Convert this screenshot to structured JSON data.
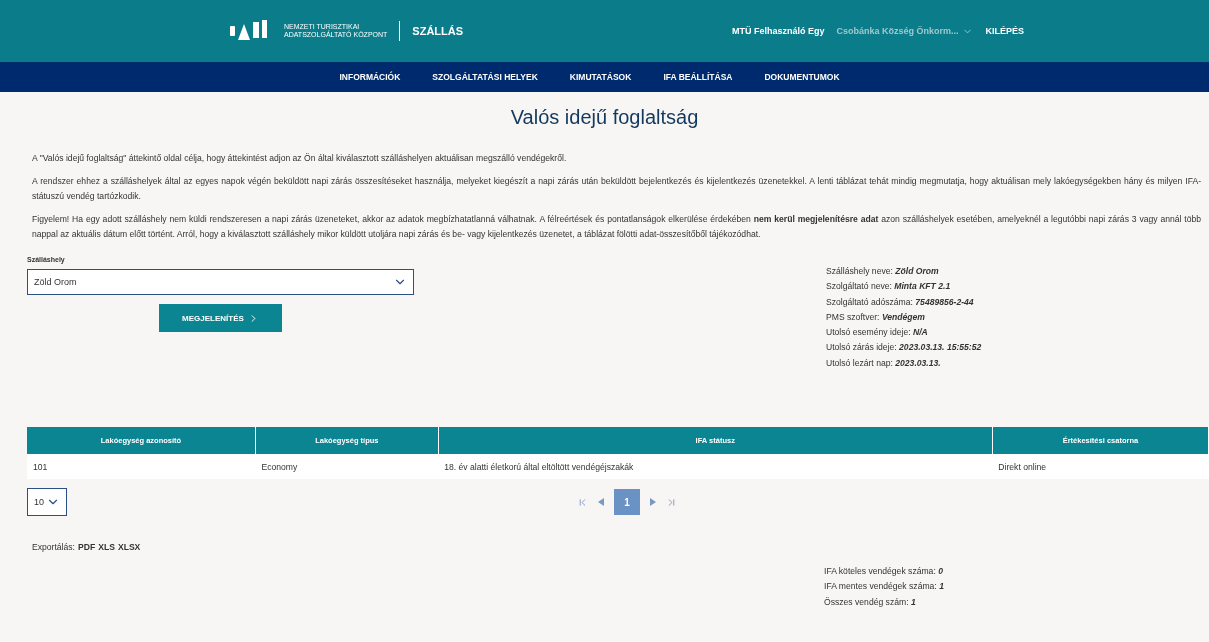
{
  "header": {
    "logo_line1": "NEMZETI TURISZTIKAI",
    "logo_line2": "ADATSZOLGÁLTATÓ KÖZPONT",
    "app_name": "SZÁLLÁS",
    "user": "MTÜ Felhasználó Egy",
    "org": "Csobánka Község Önkorm...",
    "logout": "KILÉPÉS"
  },
  "nav": {
    "items": [
      {
        "label": "INFORMÁCIÓK"
      },
      {
        "label": "SZOLGÁLTATÁSI HELYEK"
      },
      {
        "label": "KIMUTATÁSOK"
      },
      {
        "label": "IFA BEÁLLÍTÁSA"
      },
      {
        "label": "DOKUMENTUMOK"
      }
    ]
  },
  "title": "Valós idejű foglaltság",
  "intro": [
    "A \"Valós idejű foglaltság\" áttekintő oldal célja, hogy áttekintést adjon az Ön által kiválasztott szálláshelyen aktuálisan megszálló vendégekről.",
    "A rendszer ehhez a szálláshelyek által az egyes napok végén beküldött napi zárás összesítéseket használja, melyeket kiegészít a napi zárás után beküldött bejelentkezés és kijelentkezés üzenetekkel. A lenti táblázat tehát mindig megmutatja, hogy aktuálisan mely lakóegységekben hány és milyen IFA-státuszú vendég tartózkodik.",
    "Figyelem! Ha egy adott szálláshely nem küldi rendszeresen a napi zárás üzeneteket, akkor az adatok megbízhatatlanná válhatnak. A félreértések és pontatlanságok elkerülése érdekében **nem kerül megjelenítésre adat** azon szálláshelyek esetében, amelyeknél a legutóbbi napi zárás 3 vagy annál több nappal az aktuális dátum előtt történt. Arról, hogy a kiválasztott szálláshely mikor küldött utoljára napi zárás és be- vagy kijelentkezés üzenetet, a táblázat fölötti adat-összesítőből tájékozódhat."
  ],
  "form": {
    "label": "Szálláshely",
    "value": "Zöld Orom",
    "button": "MEGJELENÍTÉS"
  },
  "details": [
    {
      "label": "Szálláshely neve:",
      "value": "Zöld Orom"
    },
    {
      "label": "Szolgáltató neve:",
      "value": "Minta KFT 2.1"
    },
    {
      "label": "Szolgáltató adószáma:",
      "value": "75489856-2-44"
    },
    {
      "label": "PMS szoftver:",
      "value": "Vendégem"
    },
    {
      "label": "Utolsó esemény ideje:",
      "value": "N/A"
    },
    {
      "label": "Utolsó zárás ideje:",
      "value": "2023.03.13. 15:55:52"
    },
    {
      "label": "Utolsó lezárt nap:",
      "value": "2023.03.13."
    }
  ],
  "table": {
    "columns": [
      "Lakóegység azonosító",
      "Lakóegység típus",
      "IFA státusz",
      "Értékesítési csatorna"
    ],
    "rows": [
      [
        "101",
        "Economy",
        "18. év alatti életkorú által eltöltött vendégéjszakák",
        "Direkt online"
      ]
    ]
  },
  "pagination": {
    "page_size": "10",
    "pages": [
      {
        "label": "1",
        "selected": true
      }
    ]
  },
  "export": {
    "label": "Exportálás:",
    "formats": [
      "PDF",
      "XLS",
      "XLSX"
    ]
  },
  "summary": [
    {
      "label": "IFA köteles vendégek száma:",
      "value": "0"
    },
    {
      "label": "IFA mentes vendégek száma:",
      "value": "1"
    },
    {
      "label": "Összes vendég szám:",
      "value": "1"
    }
  ]
}
